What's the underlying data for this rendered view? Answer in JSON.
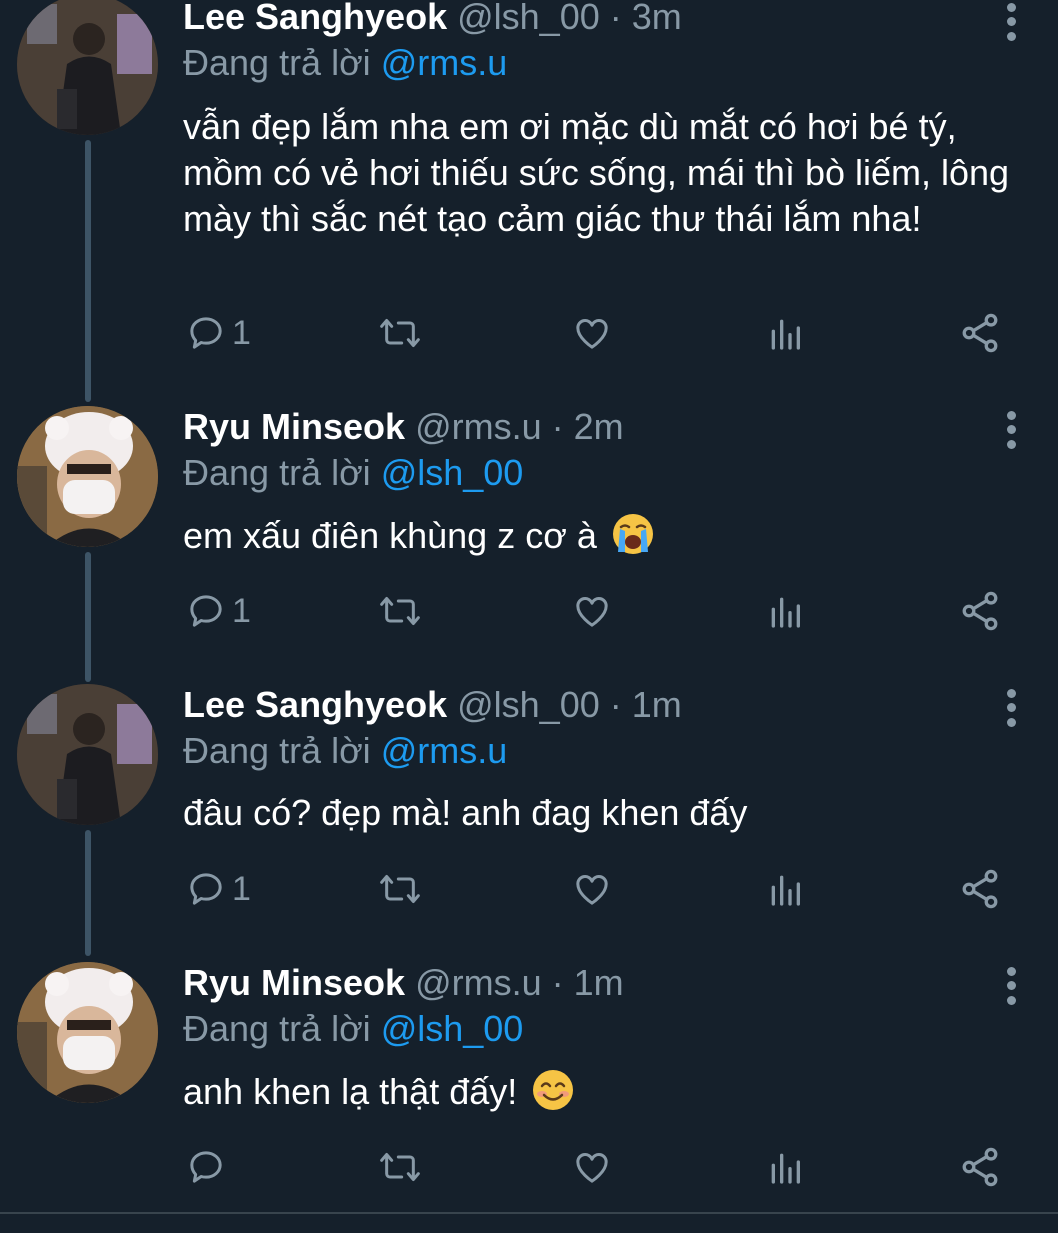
{
  "colors": {
    "background": "#15202b",
    "muted": "#8899a6",
    "mention": "#1d9bf0",
    "thread_line": "#3d5466"
  },
  "tweets": [
    {
      "name": "Lee Sanghyeok",
      "handle": "@lsh_00",
      "time": "· 3m",
      "replying_prefix": "Đang trả lời",
      "replying_to": "@rms.u",
      "text": "vẫn đẹp lắm nha em ơi mặc dù mắt có hơi bé tý, mồm có vẻ hơi thiếu sức sống, mái thì bò liếm, lông mày thì sắc nét tạo cảm giác thư thái lắm nha!",
      "reply_count": "1"
    },
    {
      "name": "Ryu Minseok",
      "handle": "@rms.u",
      "time": "· 2m",
      "replying_prefix": "Đang trả lời",
      "replying_to": "@lsh_00",
      "text": "em xấu điên khùng z cơ à",
      "emoji": "loudly-crying-face",
      "reply_count": "1"
    },
    {
      "name": "Lee Sanghyeok",
      "handle": "@lsh_00",
      "time": "· 1m",
      "replying_prefix": "Đang trả lời",
      "replying_to": "@rms.u",
      "text": "đâu có? đẹp mà! anh đag khen đấy",
      "reply_count": "1"
    },
    {
      "name": "Ryu Minseok",
      "handle": "@rms.u",
      "time": "· 1m",
      "replying_prefix": "Đang trả lời",
      "replying_to": "@lsh_00",
      "text": "anh khen lạ thật đấy!",
      "emoji": "smiling-face-with-smiling-eyes",
      "reply_count": ""
    }
  ],
  "icons": {
    "reply": "reply-icon",
    "retweet": "retweet-icon",
    "like": "heart-icon",
    "analytics": "analytics-icon",
    "share": "share-icon",
    "more": "more-vertical-icon"
  }
}
